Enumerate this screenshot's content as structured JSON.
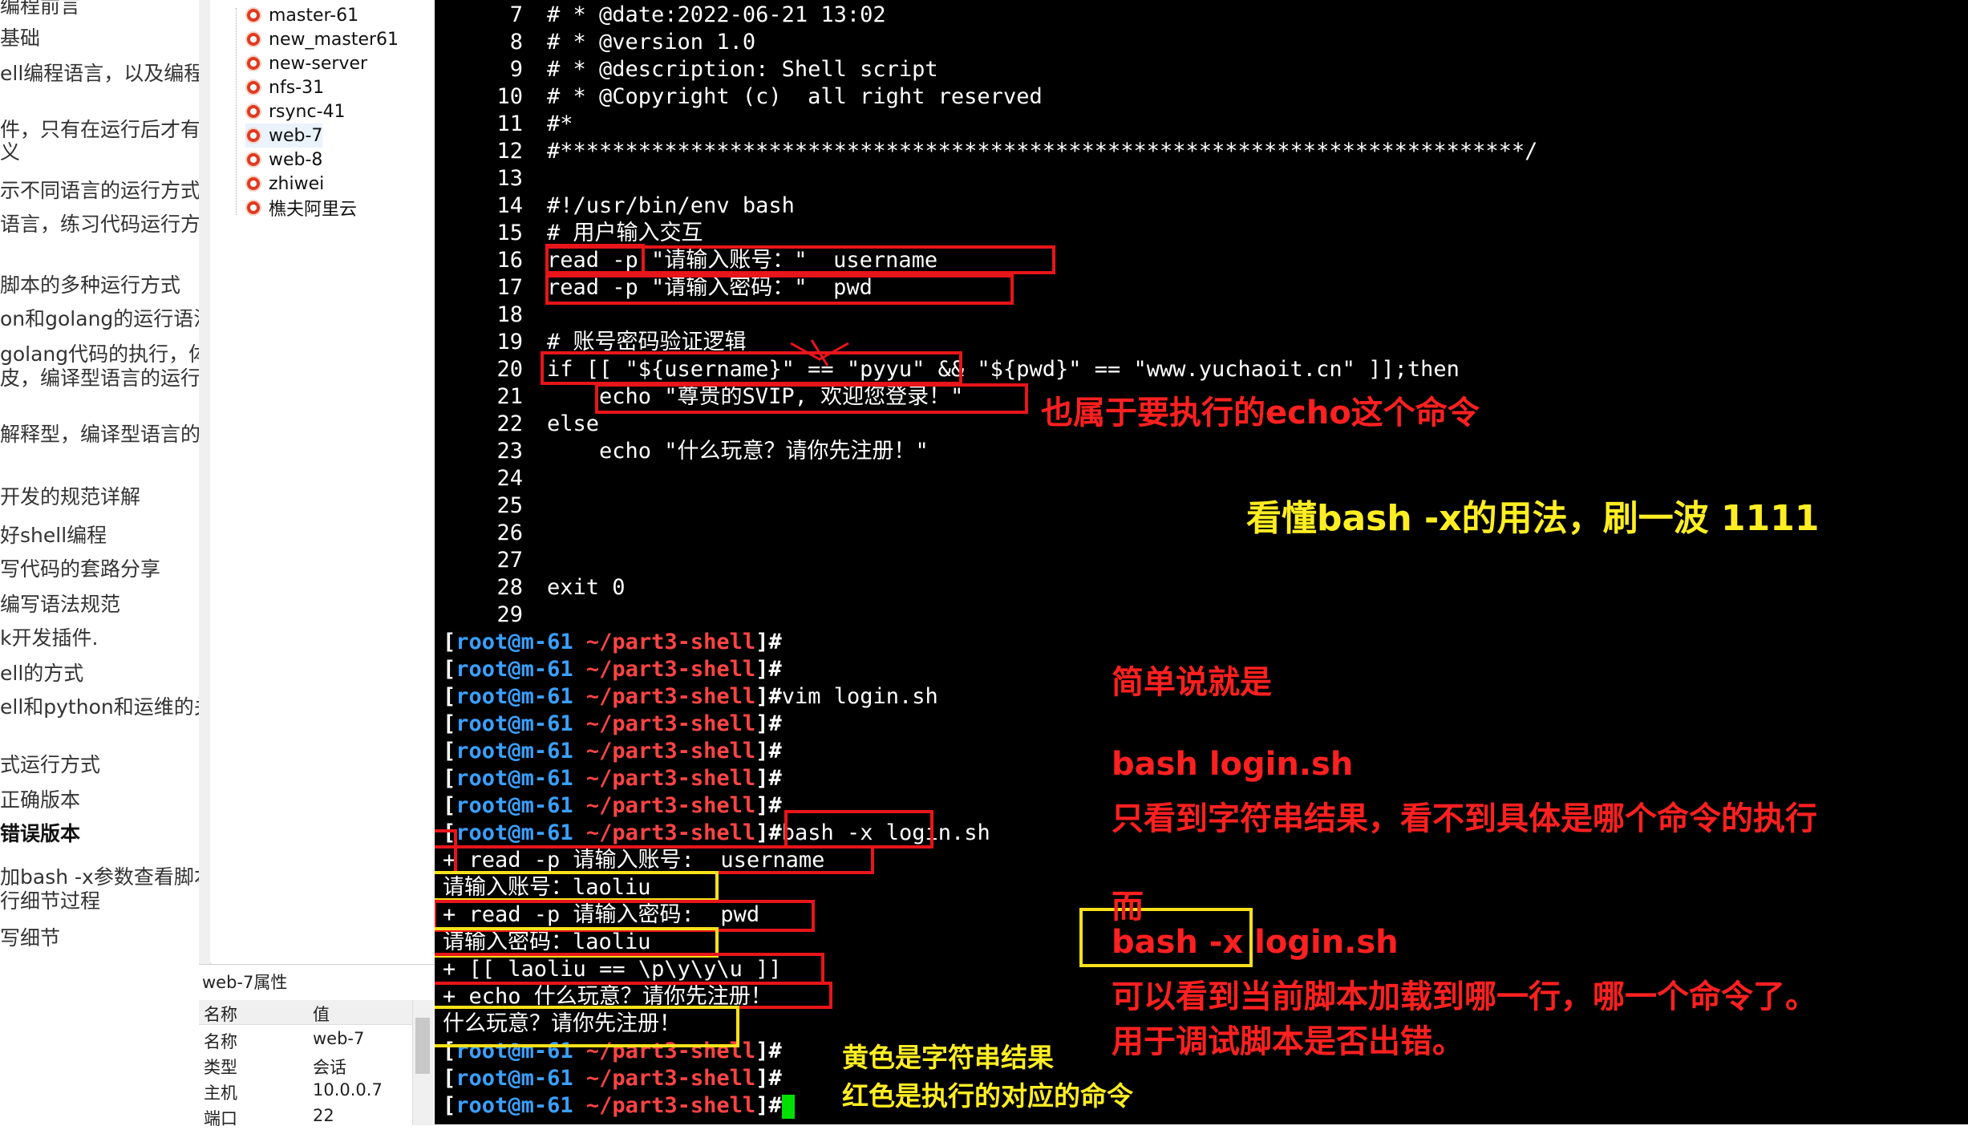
{
  "outline": {
    "items": [
      {
        "text": "编程前言",
        "bold": false
      },
      {
        "text": "基础",
        "bold": false
      },
      {
        "text": "ell编程语言，以及编程",
        "bold": false
      },
      {
        "text": "件，只有在运行后才有",
        "bold": false
      },
      {
        "text": "义",
        "bold": false
      },
      {
        "text": "示不同语言的运行方式",
        "bold": false
      },
      {
        "text": "语言，练习代码运行方",
        "bold": false
      },
      {
        "text": "脚本的多种运行方式",
        "bold": false
      },
      {
        "text": "on和golang的运行语法",
        "bold": false
      },
      {
        "text": "golang代码的执行，体",
        "bold": false
      },
      {
        "text": "皮，编译型语言的运行",
        "bold": false
      },
      {
        "text": "解释型，编译型语言的",
        "bold": false
      },
      {
        "text": "开发的规范详解",
        "bold": false
      },
      {
        "text": "好shell编程",
        "bold": false
      },
      {
        "text": "写代码的套路分享",
        "bold": false
      },
      {
        "text": "编写语法规范",
        "bold": false
      },
      {
        "text": "k开发插件.",
        "bold": false
      },
      {
        "text": "ell的方式",
        "bold": false
      },
      {
        "text": "ell和python和运维的关",
        "bold": false
      },
      {
        "text": "式运行方式",
        "bold": false
      },
      {
        "text": "正确版本",
        "bold": false
      },
      {
        "text": "错误版本",
        "bold": true
      },
      {
        "text": "加bash -x参数查看脚本",
        "bold": false
      },
      {
        "text": "行细节过程",
        "bold": false
      },
      {
        "text": "写细节",
        "bold": false
      }
    ]
  },
  "sessions": {
    "items": [
      {
        "label": "master-61",
        "selected": false
      },
      {
        "label": "new_master61",
        "selected": false
      },
      {
        "label": "new-server",
        "selected": false
      },
      {
        "label": "nfs-31",
        "selected": false
      },
      {
        "label": "rsync-41",
        "selected": false
      },
      {
        "label": "web-7",
        "selected": true
      },
      {
        "label": "web-8",
        "selected": false
      },
      {
        "label": "zhiwei",
        "selected": false
      },
      {
        "label": "樵夫阿里云",
        "selected": false
      }
    ]
  },
  "properties": {
    "title": "web-7属性",
    "col_name": "名称",
    "col_value": "值",
    "rows": [
      {
        "name": "名称",
        "value": "web-7"
      },
      {
        "name": "类型",
        "value": "会话"
      },
      {
        "name": "主机",
        "value": "10.0.0.7"
      },
      {
        "name": "端口",
        "value": "22"
      }
    ]
  },
  "terminal": {
    "code_lines": [
      {
        "num": "7",
        "text": "# * @date:2022-06-21 13:02"
      },
      {
        "num": "8",
        "text": "# * @version 1.0"
      },
      {
        "num": "9",
        "text": "# * @description: Shell script"
      },
      {
        "num": "10",
        "text": "# * @Copyright (c)  all right reserved"
      },
      {
        "num": "11",
        "text": "#*"
      },
      {
        "num": "12",
        "text": "#**************************************************************************/"
      },
      {
        "num": "13",
        "text": ""
      },
      {
        "num": "14",
        "text": "#!/usr/bin/env bash"
      },
      {
        "num": "15",
        "text": "# 用户输入交互"
      },
      {
        "num": "16",
        "text": "read -p \"请输入账号：\"  username"
      },
      {
        "num": "17",
        "text": "read -p \"请输入密码：\"  pwd"
      },
      {
        "num": "18",
        "text": ""
      },
      {
        "num": "19",
        "text": "# 账号密码验证逻辑"
      },
      {
        "num": "20",
        "text": "if [[ \"${username}\" == \"pyyu\" && \"${pwd}\" == \"www.yuchaoit.cn\" ]];then"
      },
      {
        "num": "21",
        "text": "    echo \"尊贵的SVIP, 欢迎您登录！\""
      },
      {
        "num": "22",
        "text": "else"
      },
      {
        "num": "23",
        "text": "    echo \"什么玩意？请你先注册！\""
      },
      {
        "num": "24",
        "text": ""
      },
      {
        "num": "25",
        "text": ""
      },
      {
        "num": "26",
        "text": ""
      },
      {
        "num": "27",
        "text": ""
      },
      {
        "num": "28",
        "text": "exit 0"
      },
      {
        "num": "29",
        "text": ""
      }
    ],
    "prompt": {
      "user": "root",
      "at": "@",
      "host": "m-61",
      "path": "~/part3-shell",
      "open": "[",
      "close": "]",
      "symbol": "#"
    },
    "shell_lines": [
      {
        "type": "prompt",
        "cmd": ""
      },
      {
        "type": "prompt",
        "cmd": ""
      },
      {
        "type": "prompt",
        "cmd": "vim login.sh"
      },
      {
        "type": "prompt",
        "cmd": ""
      },
      {
        "type": "prompt",
        "cmd": ""
      },
      {
        "type": "prompt",
        "cmd": ""
      },
      {
        "type": "prompt",
        "cmd": ""
      },
      {
        "type": "prompt",
        "cmd": "bash -x login.sh"
      },
      {
        "type": "out",
        "text": "+ read -p 请输入账号:  username"
      },
      {
        "type": "out",
        "text": "请输入账号：laoliu"
      },
      {
        "type": "out",
        "text": "+ read -p 请输入密码:  pwd"
      },
      {
        "type": "out",
        "text": "请输入密码：laoliu"
      },
      {
        "type": "out",
        "text": "+ [[ laoliu == \\p\\y\\y\\u ]]"
      },
      {
        "type": "out",
        "text": "+ echo 什么玩意？请你先注册！"
      },
      {
        "type": "out",
        "text": "什么玩意？请你先注册！"
      },
      {
        "type": "prompt",
        "cmd": ""
      },
      {
        "type": "prompt",
        "cmd": ""
      },
      {
        "type": "prompt",
        "cmd": "",
        "cursor": true
      }
    ]
  },
  "annotations": {
    "echo_note": "也属于要执行的echo这个命令",
    "headline": "看懂bash -x的用法，刷一波  1111",
    "simple_title": "简单说就是",
    "bash_plain": "bash  login.sh",
    "bash_plain_desc": "只看到字符串结果，看不到具体是哪个命令的执行",
    "er": "而",
    "bash_x": "bash -x login.sh",
    "bash_x_desc1": "可以看到当前脚本加载到哪一行，哪一个命令了。",
    "bash_x_desc2": "用于调试脚本是否出错。",
    "legend_yellow": "黄色是字符串结果",
    "legend_red": "红色是执行的对应的命令"
  },
  "colors": {
    "terminal_bg": "#000000",
    "annotation_red": "#e8151a",
    "annotation_yellow": "#f7e11a",
    "prompt_user": "#3aa0ff",
    "prompt_path": "#ff4444",
    "cursor": "#00e000"
  }
}
